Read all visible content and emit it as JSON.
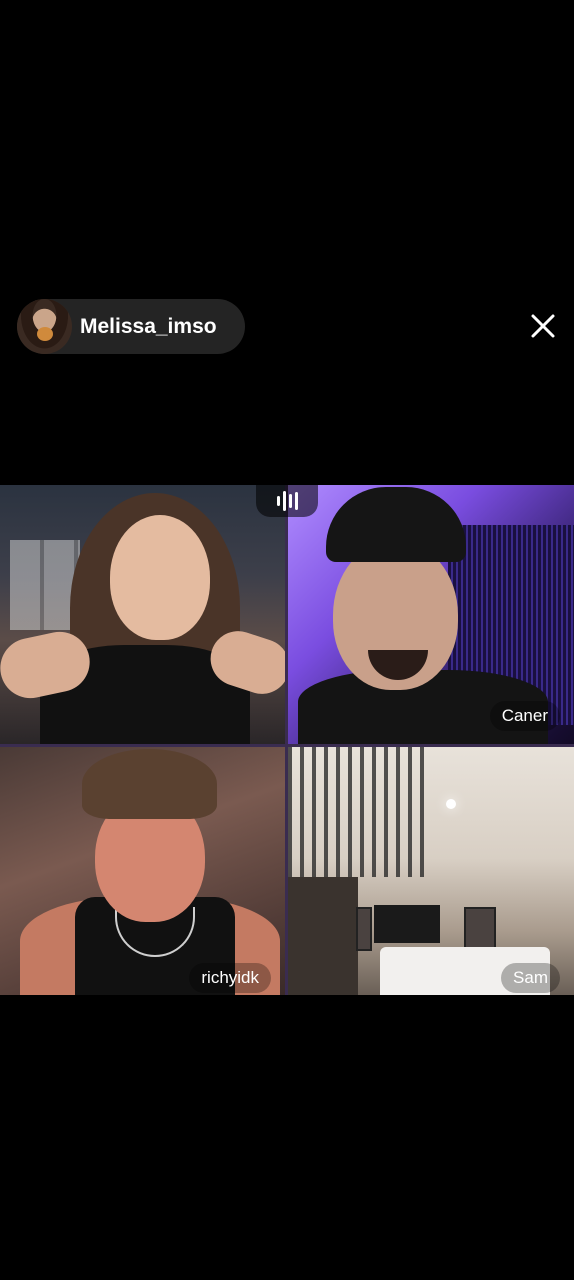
{
  "host": {
    "username": "Melissa_imso",
    "avatar_icon": "host-avatar"
  },
  "close_icon": "close-icon",
  "audio_icon": "audio-bars-icon",
  "participants": [
    {
      "name": ""
    },
    {
      "name": "Caner"
    },
    {
      "name": "richyidk"
    },
    {
      "name": "Sam"
    }
  ],
  "colors": {
    "background": "#000000",
    "grid_divider": "#3a2c50",
    "name_tag_bg": "rgba(0,0,0,0.28)"
  }
}
